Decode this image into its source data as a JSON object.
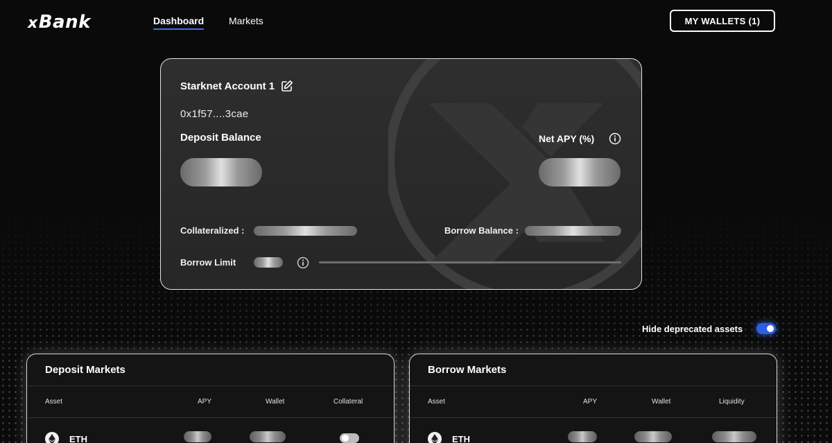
{
  "header": {
    "logo": {
      "prefix": "x",
      "name": "Bank"
    },
    "nav": [
      {
        "label": "Dashboard",
        "active": true
      },
      {
        "label": "Markets",
        "active": false
      }
    ],
    "wallet_button": "MY WALLETS (1)"
  },
  "account_card": {
    "name": "Starknet Account 1",
    "address": "0x1f57....3cae",
    "deposit_balance_label": "Deposit Balance",
    "net_apy_label": "Net APY (%)",
    "collateralized_label": "Collateralized :",
    "borrow_balance_label": "Borrow Balance :",
    "borrow_limit_label": "Borrow Limit",
    "icons": [
      "edit-icon",
      "info-icon",
      "xbank-watermark"
    ]
  },
  "filters": {
    "hide_deprecated_label": "Hide deprecated assets",
    "hide_deprecated_on": true
  },
  "deposit_markets": {
    "title": "Deposit Markets",
    "columns": [
      "Asset",
      "APY",
      "Wallet",
      "Collateral"
    ],
    "rows": [
      {
        "asset": "ETH",
        "icon": "ethereum-icon",
        "collateral_enabled": false
      }
    ]
  },
  "borrow_markets": {
    "title": "Borrow Markets",
    "columns": [
      "Asset",
      "APY",
      "Wallet",
      "Liquidity"
    ],
    "rows": [
      {
        "asset": "ETH",
        "icon": "ethereum-icon"
      }
    ]
  },
  "colors": {
    "background": "#0a0a0a",
    "accent": "#3f6ff0",
    "card": "#2a2a2a"
  }
}
